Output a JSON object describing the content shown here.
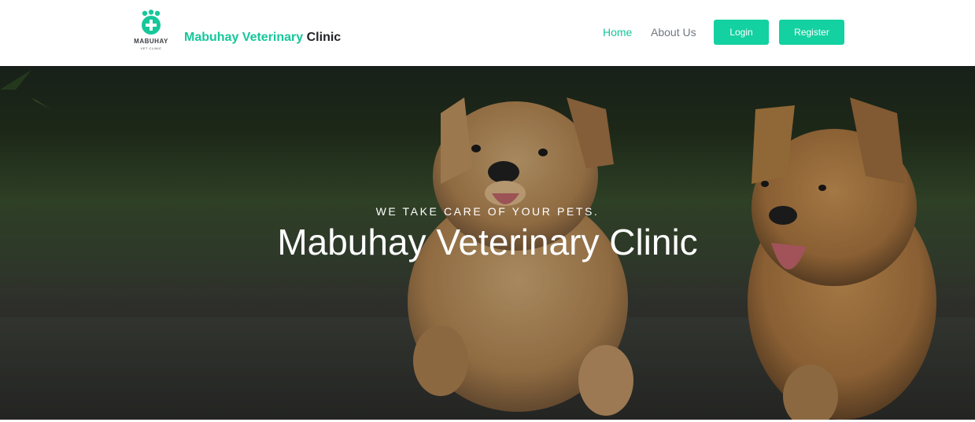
{
  "header": {
    "logo_text": "MABUHAY",
    "logo_subtext": "VET CLINIC",
    "brand_part1": "Mabuhay Veterinary",
    "brand_part2": "Clinic",
    "nav": {
      "home": "Home",
      "about": "About Us"
    },
    "buttons": {
      "login": "Login",
      "register": "Register"
    }
  },
  "hero": {
    "tagline": "WE TAKE CARE OF YOUR PETS.",
    "title": "Mabuhay Veterinary Clinic"
  },
  "colors": {
    "accent": "#16c79a",
    "button": "#13d1a0",
    "dark_text": "#1f2226",
    "nav_text": "#707880"
  },
  "icons": [
    "paw-cross-logo-icon"
  ]
}
